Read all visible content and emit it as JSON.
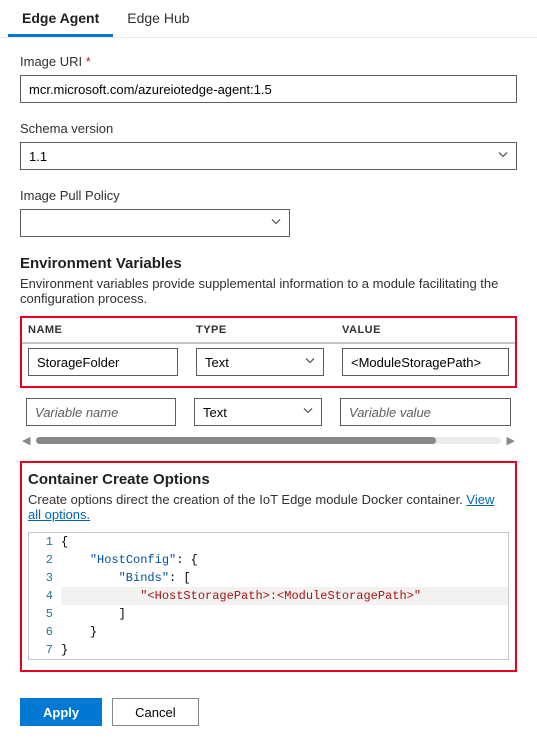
{
  "tabs": {
    "edge_agent": "Edge Agent",
    "edge_hub": "Edge Hub"
  },
  "image_uri": {
    "label": "Image URI",
    "required_mark": "*",
    "value": "mcr.microsoft.com/azureiotedge-agent:1.5"
  },
  "schema_version": {
    "label": "Schema version",
    "value": "1.1"
  },
  "pull_policy": {
    "label": "Image Pull Policy",
    "value": ""
  },
  "env": {
    "title": "Environment Variables",
    "desc": "Environment variables provide supplemental information to a module facilitating the configuration process.",
    "headers": {
      "name": "NAME",
      "type": "TYPE",
      "value": "VALUE"
    },
    "rows": [
      {
        "name": "StorageFolder",
        "type": "Text",
        "value": "<ModuleStoragePath>"
      },
      {
        "name_ph": "Variable name",
        "type": "Text",
        "value_ph": "Variable value"
      }
    ]
  },
  "cco": {
    "title": "Container Create Options",
    "desc_prefix": "Create options direct the creation of the IoT Edge module Docker container. ",
    "link": "View all options.",
    "code": {
      "line1": "{",
      "line2_key": "\"HostConfig\"",
      "line2_rest": ": {",
      "line3_key": "\"Binds\"",
      "line3_rest": ": [",
      "line4_str": "\"<HostStoragePath>:<ModuleStoragePath>\"",
      "line5": "]",
      "line6": "}",
      "line7": "}",
      "nums": [
        "1",
        "2",
        "3",
        "4",
        "5",
        "6",
        "7"
      ]
    }
  },
  "footer": {
    "apply": "Apply",
    "cancel": "Cancel"
  }
}
